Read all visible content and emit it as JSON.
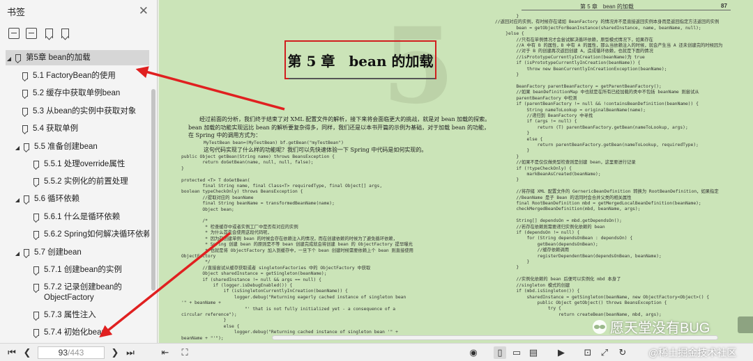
{
  "sidebar": {
    "title": "书签",
    "toc": [
      {
        "label": "第5章 bean的加载",
        "expanded": true,
        "selected": true
      },
      {
        "label": "5.1 FactoryBean的使用"
      },
      {
        "label": "5.2 缓存中获取单例bean"
      },
      {
        "label": "5.3 从bean的实例中获取对象"
      },
      {
        "label": "5.4 获取单例"
      },
      {
        "label": "5.5 准备创建bean",
        "expanded": true
      },
      {
        "label": "5.5.1 处理override属性"
      },
      {
        "label": "5.5.2 实例化的前置处理"
      },
      {
        "label": "5.6 循环依赖",
        "expanded": true
      },
      {
        "label": "5.6.1 什么是循环依赖"
      },
      {
        "label": "5.6.2 Spring如何解决循环依赖"
      },
      {
        "label": "5.7 创建bean",
        "expanded": true
      },
      {
        "label": "5.7.1 创建bean的实例"
      },
      {
        "label": "5.7.2 记录创建bean的ObjectFactory"
      },
      {
        "label": "5.7.3 属性注入"
      },
      {
        "label": "5.7.4 初始化bean"
      }
    ]
  },
  "document": {
    "right_header": "第 5 章　bean 的加载",
    "right_page_number": "87",
    "chapter_title": "第 5 章　bean 的加载",
    "chapter_number": "5",
    "intro": "经过前面的分析，我们终于结束了对 XML 配置文件的解析，接下来将会面临更大的挑战，就是对 bean 加载的探索。bean 加载的功能实现远比 bean 的解析要复杂得多，同样，我们还是以本书开篇的示例为基础，对于加载 bean 的功能，在 Spring 中的调用方式为：",
    "code1": "MyTestBean bean=(MyTestBean) bf.getBean(\"myTestBean\")",
    "q": "这句代码实现了什么样的功能呢？我们可以先快速体验一下 Spring 中代码是如何实现的。",
    "code2": "public Object getBean(String name) throws BeansException {\n        return doGetBean(name, null, null, false);\n}\n\nprotected <T> T doGetBean(\n        final String name, final Class<T> requiredType, final Object[] args,\nboolean typeCheckOnly) throws BeansException {\n        //提取对应的 beanName\n        final String beanName = transformedBeanName(name);\n        Object bean;\n\n        /*\n         * 检查缓存中或者实例工厂中是否有对应的实例\n         * 为什么首先会使用这段代码呢，\n         * 因为在创建单例 bean 的时候会存在依赖注入的情况，而在创建依赖的时候为了避免循环依赖，\n         * Spring 创建 bean 的原则是不等 bean 创建完成就会将创建 bean 的 ObjectFactory 提早曝光\n         * 也就是将 ObjectFactory 加入到缓存中，一旦下个 bean 创建时候需要依赖上个 bean 则直接使用\nObjectFactory\n         */\n        //直接尝试从缓存获取或者 singletonFactories 中的 ObjectFactory 中获取\n        Object sharedInstance = getSingleton(beanName);\n        if (sharedInstance != null && args == null) {\n            if (logger.isDebugEnabled()) {\n                if (isSingletonCurrentlyInCreation(beanName)) {\n                    logger.debug(\"Returning eagerly cached instance of singleton bean\n'\" + beanName +\n                        \"' that is not fully initialized yet - a consequence of a\ncircular reference\");\n                }\n                else {\n                    logger.debug(\"Returning cached instance of singleton bean '\" +\nbeanName + \"'\");",
    "code3": "        }\n//返回对应的实例，有时候存在诸如 BeanFactory 的情况并不是直接返回实例本身而是返回指定方法返回的实例\n        bean = getObjectForBeanInstance(sharedInstance, name, beanName, null);\n    }else {\n        //只有在单例情况才会尝试解决循环依赖，原型模式情况下，如果存在\n        //A 中有 B 的属性，B 中有 A 的属性，那么当依赖注入的时候，就会产生当 A 还未创建完的时候因为\n        //对于 B 的创建再次返回创建 A，造成循环依赖，也就是下面的情况\n        //isPrototypeCurrentlyInCreation(beanName)为 true\n        if (isPrototypeCurrentlyInCreation(beanName)) {\n            throw new BeanCurrentlyInCreationException(beanName);\n        }\n\n        BeanFactory parentBeanFactory = getParentBeanFactory();\n        //如果 beanDefinitionMap 中也就是在所有已经加载的类中不包括 beanName 则尝试从\n        parentBeanFactory 中检测\n        if (parentBeanFactory != null && !containsBeanDefinition(beanName)) {\n            String nameToLookup = originalBeanName(name);\n            //递归到 BeanFactory 中寻找\n            if (args != null) {\n                return (T) parentBeanFactory.getBean(nameToLookup, args);\n            }\n            else {\n                return parentBeanFactory.getBean(nameToLookup, requiredType);\n            }\n        }\n        //如果不是仅仅做类型检查则是创建 bean，这里要进行记录\n        if (!typeCheckOnly) {\n            markBeanAsCreated(beanName);\n        }\n\n        //将存储 XML 配置文件的 GernericBeanDefinition 转换为 RootBeanDefinition，如果指定\n        //BeanName 是子 Bean 的话同时会合并父类的相关属性\n        final RootBeanDefinition mbd = getMergedLocalBeanDefinition(beanName);\n        checkMergedBeanDefinition(mbd, beanName, args);\n\n        String[] dependsOn = mbd.getDependsOn();\n        //若存在依赖则需要递归实例化依赖的 bean\n        if (dependsOn != null) {\n            for (String dependsOnBean : dependsOn) {\n                getBean(dependsOnBean);\n                //缓存依赖调用\n                registerDependentBean(dependsOnBean, beanName);\n            }\n        }\n\n        //实例化依赖的 bean 后便可以实例化 mbd 本身了\n        //singleton 模式的创建\n        if (mbd.isSingleton()) {\n            sharedInstance = getSingleton(beanName, new ObjectFactory<Object>() {\n                public Object getObject() throws BeansException {\n                    try {\n                        return createBean(beanName, mbd, args);"
  },
  "watermarks": {
    "w1": "愿天堂没有BUG",
    "w2": "@稀土掘金技术社区"
  },
  "bottom": {
    "current_page": "93",
    "total_pages": "/443"
  },
  "colors": {
    "page_bg": "#cbe4b8",
    "highlight": "#d11e1e",
    "arrow": "#e02020"
  }
}
